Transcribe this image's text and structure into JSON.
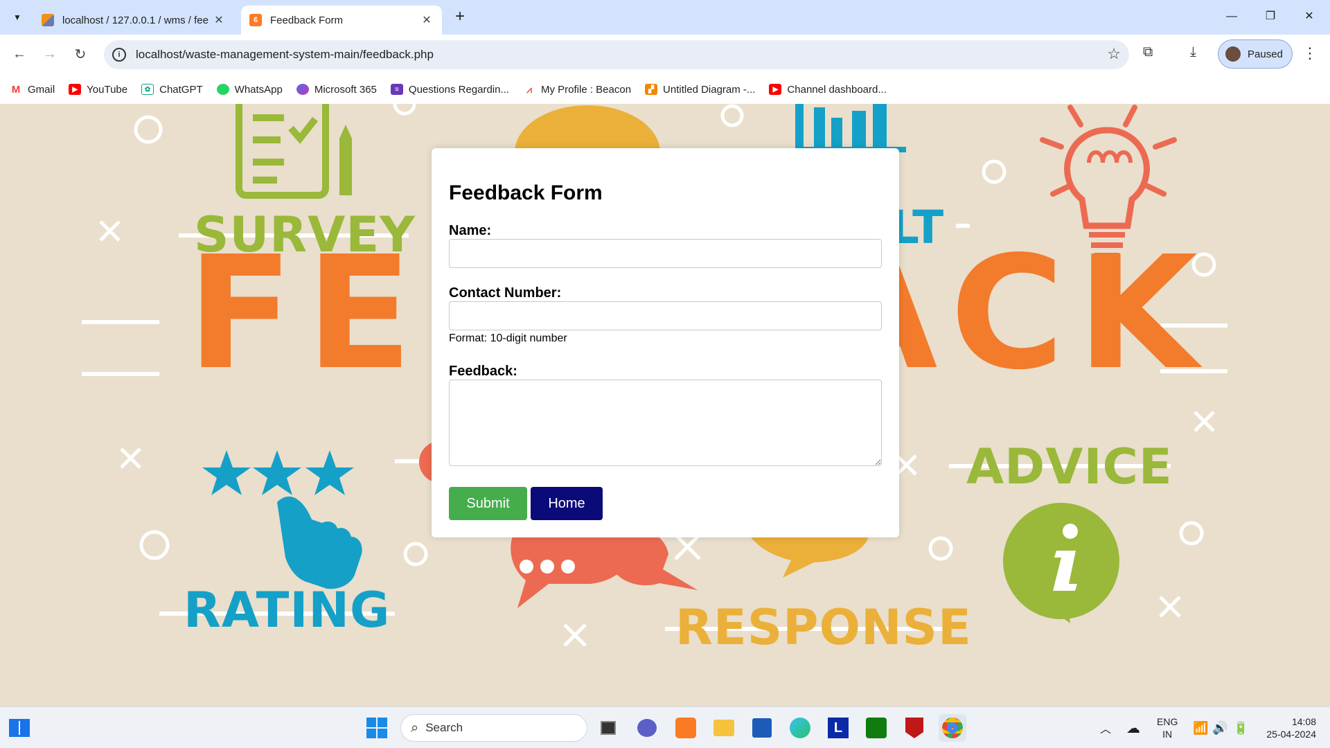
{
  "browser": {
    "tabs": [
      {
        "title": "localhost / 127.0.0.1 / wms / fee",
        "favicon": "phpmyadmin-icon",
        "active": false
      },
      {
        "title": "Feedback Form",
        "favicon": "xampp-icon",
        "active": true
      }
    ],
    "url": "localhost/waste-management-system-main/feedback.php",
    "profile_label": "Paused",
    "bookmarks": [
      {
        "label": "Gmail",
        "icon": "gmail-icon"
      },
      {
        "label": "YouTube",
        "icon": "youtube-icon"
      },
      {
        "label": "ChatGPT",
        "icon": "chatgpt-icon"
      },
      {
        "label": "WhatsApp",
        "icon": "whatsapp-icon"
      },
      {
        "label": "Microsoft 365",
        "icon": "microsoft365-icon"
      },
      {
        "label": "Questions Regardin...",
        "icon": "forms-icon"
      },
      {
        "label": "My Profile : Beacon",
        "icon": "beacon-icon"
      },
      {
        "label": "Untitled Diagram -...",
        "icon": "drawio-icon"
      },
      {
        "label": "Channel dashboard...",
        "icon": "youtube-icon"
      }
    ]
  },
  "background": {
    "words": [
      "SURVEY",
      "FEEDBACK",
      "LT",
      "ADVICE",
      "RATING",
      "RESPONSE"
    ]
  },
  "form": {
    "title": "Feedback Form",
    "name_label": "Name:",
    "name_value": "",
    "contact_label": "Contact Number:",
    "contact_value": "",
    "contact_hint": "Format: 10-digit number",
    "feedback_label": "Feedback:",
    "feedback_value": "",
    "submit_label": "Submit",
    "home_label": "Home"
  },
  "taskbar": {
    "search_placeholder": "Search",
    "language": "ENG",
    "region": "IN",
    "time": "14:08",
    "date": "25-04-2024"
  },
  "colors": {
    "background": "#e9dfcc",
    "orange": "#f37b2c",
    "green": "#9ab83a",
    "blue": "#15a0c7",
    "yellow": "#ebb03a",
    "red": "#ec6a52",
    "submit": "#45ad4c",
    "home": "#0a0a78"
  }
}
